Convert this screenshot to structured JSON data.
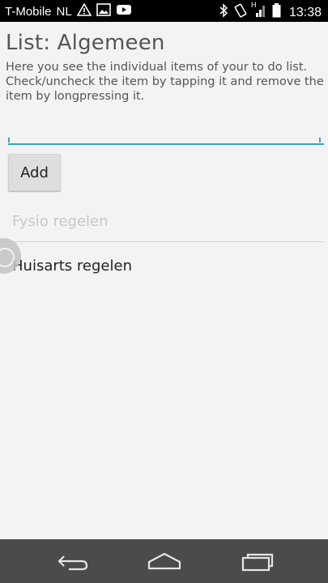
{
  "status_bar": {
    "carrier": "T-Mobile",
    "region": "NL",
    "network_indicator": "H",
    "time": "13:38",
    "icons": [
      "alert-icon",
      "image-icon",
      "youtube-icon",
      "bluetooth-icon",
      "vibrate-icon",
      "signal-icon",
      "battery-icon"
    ]
  },
  "page": {
    "title": "List: Algemeen",
    "description": "Here you see the individual items of your to do list. Check/uncheck the item by tapping it and remove the item by longpressing it."
  },
  "input": {
    "value": "",
    "placeholder": ""
  },
  "add_button": {
    "label": "Add"
  },
  "items": [
    {
      "label": "Fysio regelen",
      "checked": true
    },
    {
      "label": "Huisarts regelen",
      "checked": false
    }
  ],
  "nav": {
    "buttons": [
      "back-icon",
      "home-icon",
      "recent-apps-icon"
    ]
  },
  "colors": {
    "accent": "#3aa3c6",
    "status_bar": "#000000",
    "nav_bar": "#4b4b4b",
    "background": "#f3f3f3"
  }
}
